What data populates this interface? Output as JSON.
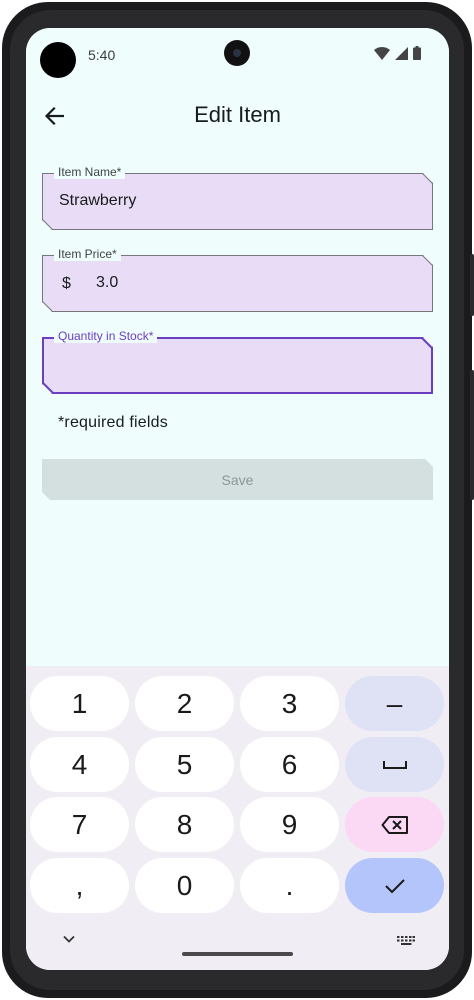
{
  "status_bar": {
    "time": "5:40"
  },
  "app_bar": {
    "title": "Edit Item"
  },
  "form": {
    "item_name": {
      "label": "Item Name*",
      "value": "Strawberry"
    },
    "item_price": {
      "label": "Item Price*",
      "prefix": "$",
      "value": "3.0"
    },
    "quantity": {
      "label": "Quantity in Stock*",
      "value": ""
    },
    "required_note": "*required fields",
    "save_label": "Save"
  },
  "keyboard": {
    "keys": [
      "1",
      "2",
      "3",
      "4",
      "5",
      "6",
      "7",
      "8",
      "9",
      ",",
      "0",
      "."
    ],
    "minus": "–"
  },
  "colors": {
    "background": "#f0fdfd",
    "field_fill": "#e8dcf6",
    "focus": "#6a3fc4",
    "save_disabled": "#d4e0e0",
    "key_done": "#b4c5fb",
    "key_delete": "#fbd8f3"
  }
}
